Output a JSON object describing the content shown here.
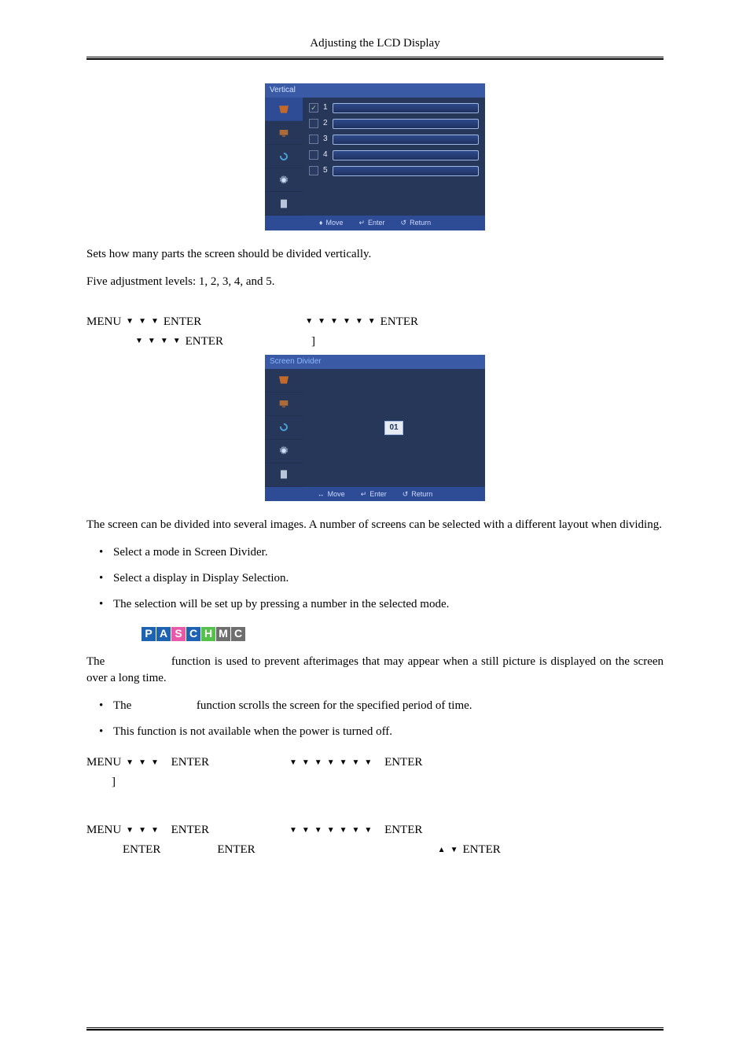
{
  "header": {
    "title": "Adjusting the LCD Display"
  },
  "osd1": {
    "title": "Vertical",
    "rows": [
      {
        "label": "1",
        "checked": true
      },
      {
        "label": "2",
        "checked": false
      },
      {
        "label": "3",
        "checked": false
      },
      {
        "label": "4",
        "checked": false
      },
      {
        "label": "5",
        "checked": false
      }
    ],
    "footer": {
      "move": "Move",
      "enter": "Enter",
      "return": "Return"
    }
  },
  "text": {
    "p1": "Sets how many parts the screen should be divided vertically.",
    "p2": "Five adjustment levels: 1, 2, 3, 4, and 5."
  },
  "menuline1": {
    "menu": "MENU",
    "enter": "ENTER",
    "bracket": "]"
  },
  "osd2": {
    "title": "Screen Divider",
    "value": "01",
    "footer": {
      "move": "Move",
      "enter": "Enter",
      "return": "Return"
    }
  },
  "section2": {
    "p1": "The screen can be divided into several images. A number of screens can be selected with a different layout when dividing.",
    "bullets": [
      "Select a mode in Screen Divider.",
      "Select a display in Display Selection.",
      "The selection will be set up by pressing a number in the selected mode."
    ]
  },
  "badges": [
    {
      "letter": "P",
      "bg": "#1e63b2"
    },
    {
      "letter": "A",
      "bg": "#1e63b2"
    },
    {
      "letter": "S",
      "bg": "#e85aa7"
    },
    {
      "letter": "C",
      "bg": "#1e63b2"
    },
    {
      "letter": "H",
      "bg": "#54c24a"
    },
    {
      "letter": "M",
      "bg": "#6f6f6f"
    },
    {
      "letter": "C",
      "bg": "#6f6f6f"
    }
  ],
  "section3": {
    "p1a": "The",
    "p1b": "function is used to prevent afterimages that may appear when a still picture is displayed on the screen over a long time.",
    "bullet1a": "The",
    "bullet1b": "function scrolls the screen for the specified period of time.",
    "bullet2": "This function is not available when the power is turned off."
  },
  "menuline2": {
    "menu": "MENU",
    "enter": "ENTER",
    "bracket": "]"
  },
  "menuline3": {
    "menu": "MENU",
    "enter": "ENTER"
  }
}
